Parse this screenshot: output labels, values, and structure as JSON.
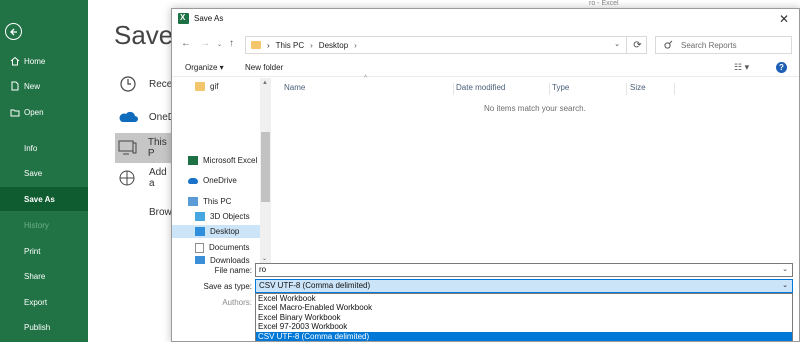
{
  "backstage": {
    "title": "Save",
    "window_hint": "ro  -  Excel",
    "nav": [
      {
        "label": "Home",
        "icon": "home-icon"
      },
      {
        "label": "New",
        "icon": "new-document-icon"
      },
      {
        "label": "Open",
        "icon": "open-folder-icon"
      },
      {
        "label": "Info"
      },
      {
        "label": "Save"
      },
      {
        "label": "Save As",
        "active": true
      },
      {
        "label": "History",
        "disabled": true
      },
      {
        "label": "Print"
      },
      {
        "label": "Share"
      },
      {
        "label": "Export"
      },
      {
        "label": "Publish"
      }
    ],
    "locations": [
      {
        "label": "Rece",
        "icon": "clock-icon"
      },
      {
        "label": "OneD",
        "icon": "onedrive-cloud-icon"
      },
      {
        "label": "This P",
        "icon": "this-pc-icon",
        "selected": true
      },
      {
        "label": "Add a",
        "icon": "add-place-icon"
      },
      {
        "label": "Brow",
        "icon": ""
      }
    ]
  },
  "dialog": {
    "title": "Save As",
    "breadcrumb": [
      "This PC",
      "Desktop"
    ],
    "search_placeholder": "Search Reports",
    "toolbar": {
      "organize": "Organize ▾",
      "new_folder": "New folder"
    },
    "nav_tree": [
      {
        "label": "gif",
        "icon": "folder"
      },
      {
        "label": "Microsoft Excel",
        "icon": "excel"
      },
      {
        "label": "OneDrive",
        "icon": "cloud"
      },
      {
        "label": "This PC",
        "icon": "pc"
      },
      {
        "label": "3D Objects",
        "icon": "objects3d"
      },
      {
        "label": "Desktop",
        "icon": "desktop",
        "selected": true
      },
      {
        "label": "Documents",
        "icon": "documents"
      },
      {
        "label": "Downloads",
        "icon": "downloads"
      }
    ],
    "columns": [
      "Name",
      "Date modified",
      "Type",
      "Size"
    ],
    "empty_message": "No items match your search.",
    "file_name_label": "File name:",
    "file_name_value": "ro",
    "save_as_type_label": "Save as type:",
    "save_as_type_value": "CSV UTF-8 (Comma delimited)",
    "authors_label": "Authors:",
    "type_options": [
      "Excel Workbook",
      "Excel Macro-Enabled Workbook",
      "Excel Binary Workbook",
      "Excel 97-2003 Workbook",
      "CSV UTF-8 (Comma delimited)"
    ],
    "selected_type_index": 4
  },
  "colors": {
    "backstage_green": "#217346",
    "active_green": "#0e5c2f",
    "selection_blue": "#0078d7",
    "selection_light": "#cce4f7"
  }
}
